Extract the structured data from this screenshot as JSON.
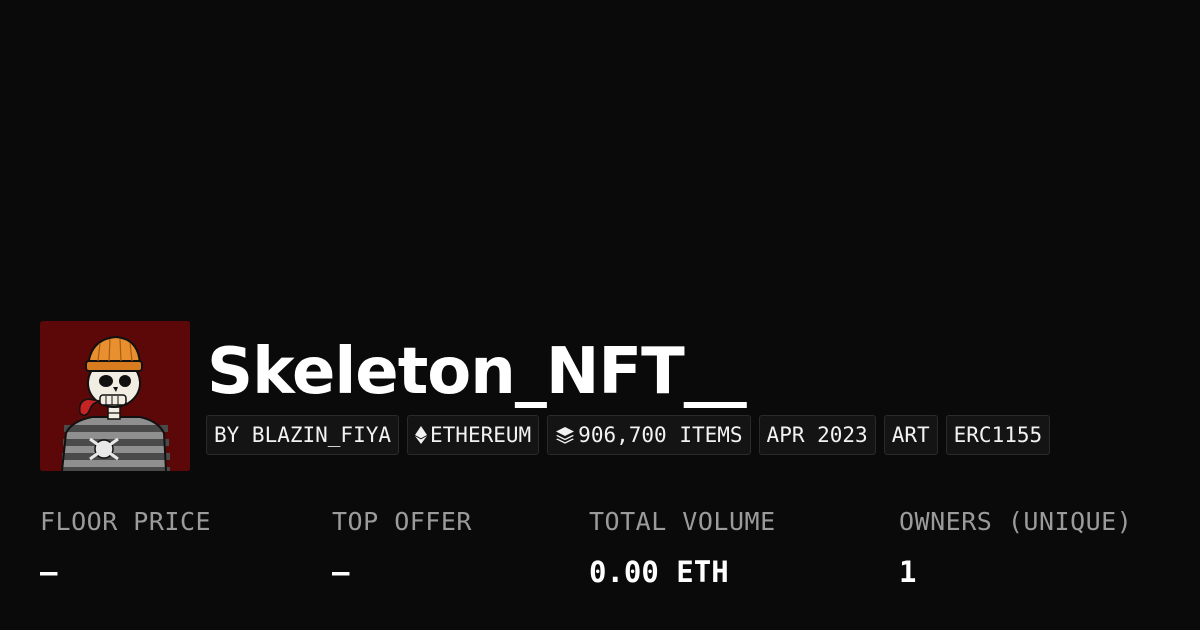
{
  "collection": {
    "name": "Skeleton_NFT__",
    "avatar_icon": "skeleton-beanie-avatar",
    "avatar_bg": "#5c0808",
    "tags": {
      "creator": "BY BLAZIN_FIYA",
      "chain": "ETHEREUM",
      "chain_icon": "ethereum-icon",
      "items": "906,700 ITEMS",
      "items_icon": "layers-icon",
      "date": "APR 2023",
      "category": "ART",
      "standard": "ERC1155"
    }
  },
  "stats": {
    "floor_price": {
      "label": "FLOOR PRICE",
      "value": "–"
    },
    "top_offer": {
      "label": "TOP OFFER",
      "value": "–"
    },
    "total_volume": {
      "label": "TOTAL VOLUME",
      "value": "0.00 ETH"
    },
    "owners": {
      "label": "OWNERS (UNIQUE)",
      "value": "1"
    }
  },
  "colors": {
    "background": "#0a0a0a",
    "tag_background": "#141414",
    "label": "#9b9b9b",
    "text": "#ffffff"
  }
}
